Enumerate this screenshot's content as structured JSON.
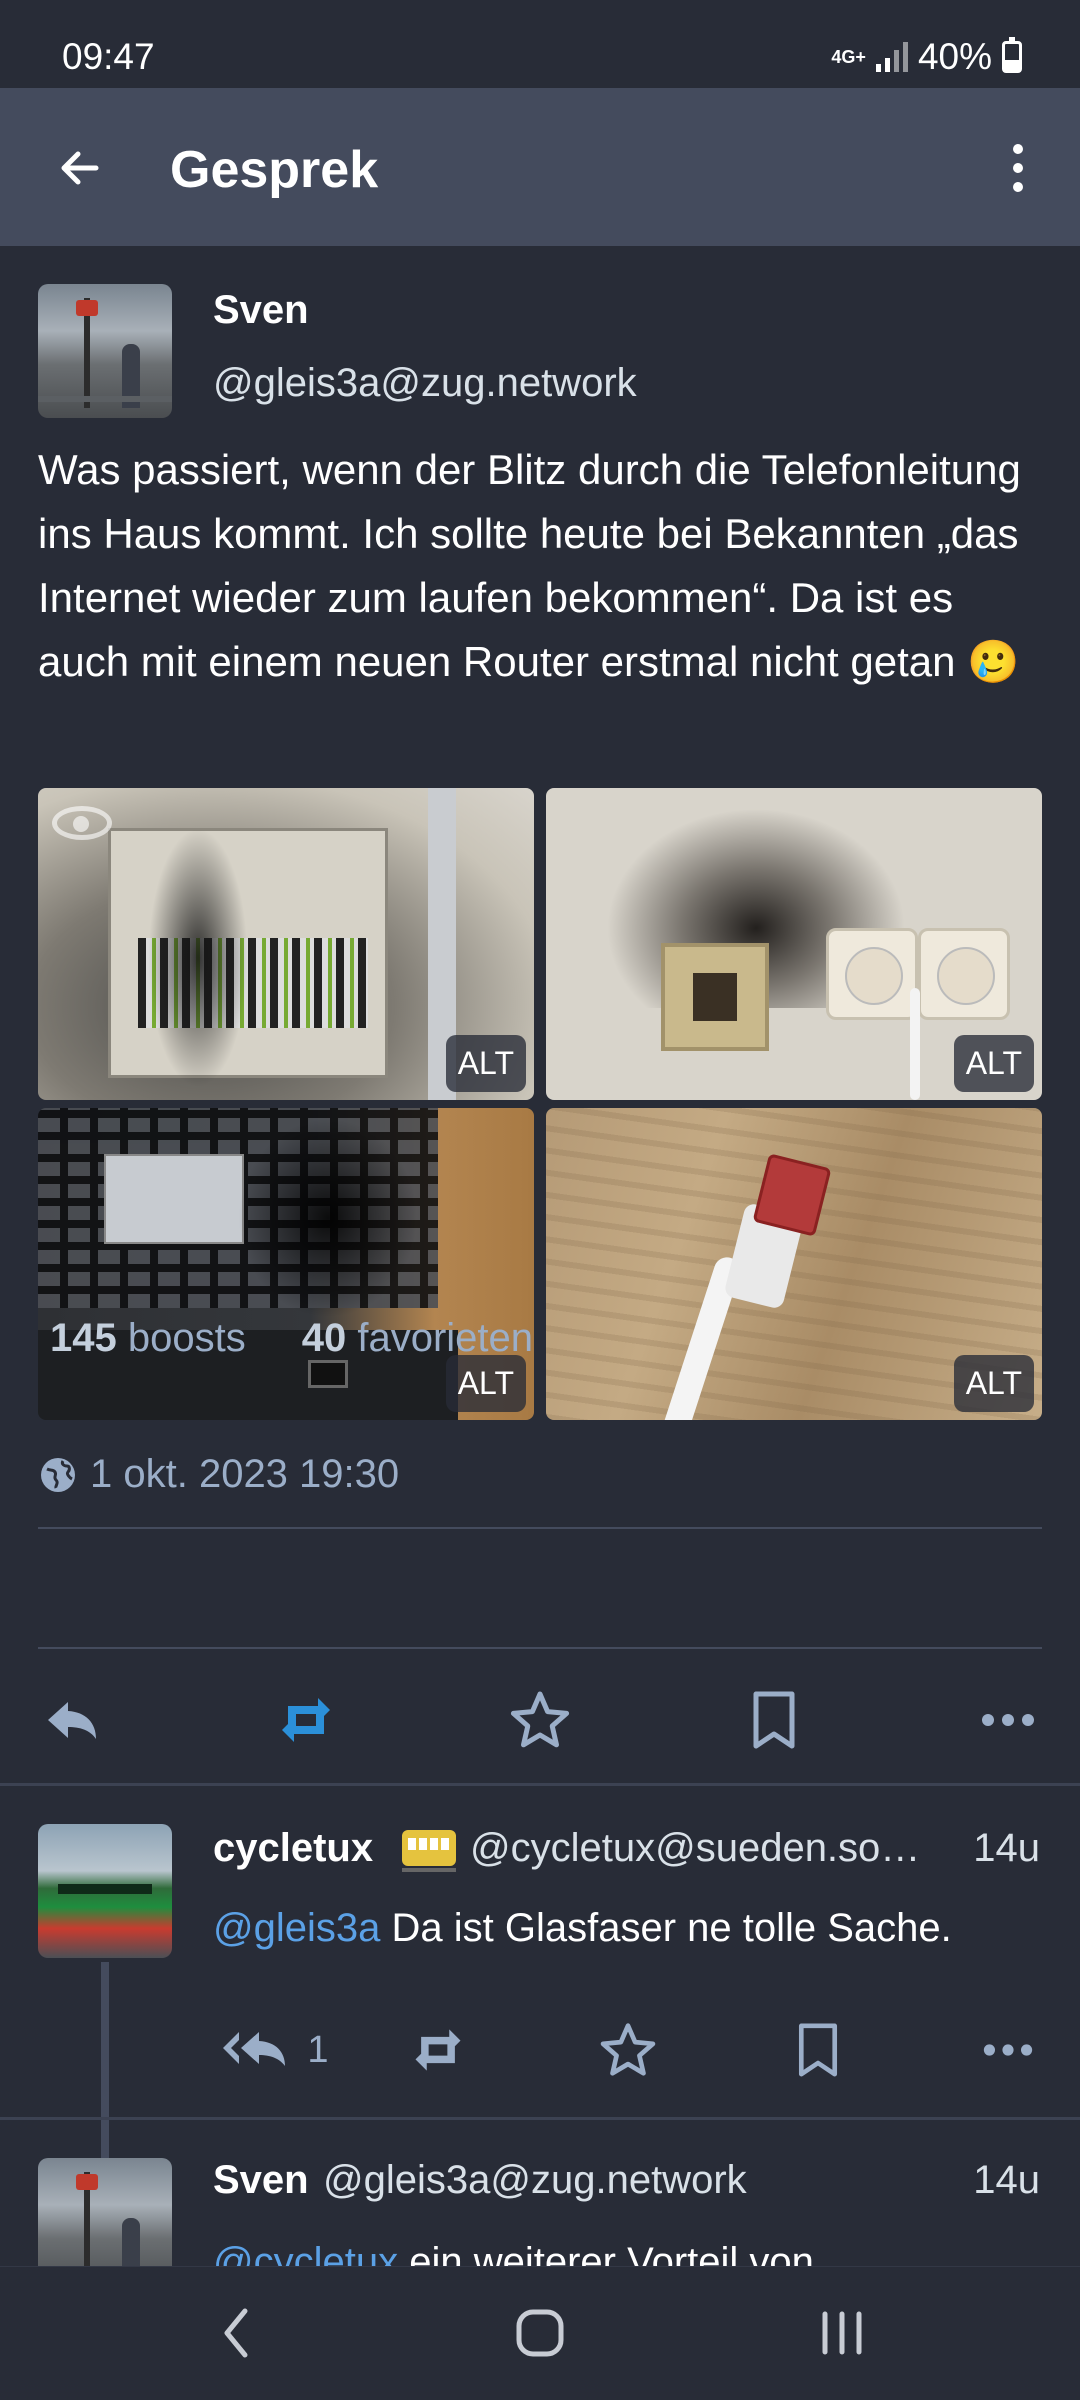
{
  "status_bar": {
    "time": "09:47",
    "network": "4G+",
    "battery": "40%",
    "battery_level": 0.4
  },
  "app_bar": {
    "title": "Gesprek"
  },
  "main_status": {
    "author_name": "Sven",
    "author_handle": "@gleis3a@zug.network",
    "text": "Was passiert, wenn der Blitz durch die Tele­fonleitung ins Haus kommt. Ich sollte heute bei Bekannten „das Internet wieder zum laufen bekommen“. Da ist es auch mit einem neuen Router erstmal nicht getan 🥲",
    "media": [
      {
        "alt_badge": "ALT"
      },
      {
        "alt_badge": "ALT"
      },
      {
        "alt_badge": "ALT"
      },
      {
        "alt_badge": "ALT"
      }
    ],
    "timestamp": "1 okt. 2023 19:30",
    "boosts_count": "145",
    "boosts_label": "boosts",
    "favourites_count": "40",
    "favourites_label": "favorieten"
  },
  "replies": [
    {
      "name": "cycletux",
      "handle": "@cycletux@sueden.so…",
      "time": "14u",
      "mention": "@gleis3a",
      "text": " Da ist Glasfaser ne tolle Sache.",
      "reply_count": "1"
    },
    {
      "name": "Sven",
      "handle": "@gleis3a@zug.network",
      "time": "14u",
      "mention": "@cycletux",
      "text": " ein weiterer Vorteil von"
    }
  ],
  "colors": {
    "background": "#282c37",
    "app_bar": "#444b5d",
    "accent_boost": "#2b90d9",
    "mention": "#5ba1e6",
    "muted": "#9baec8"
  }
}
